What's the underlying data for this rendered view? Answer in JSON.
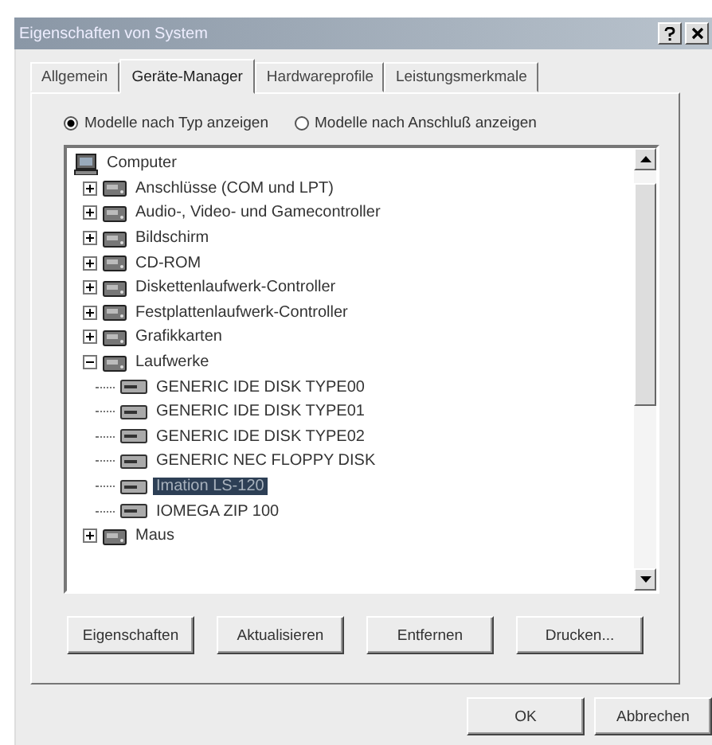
{
  "window": {
    "title": "Eigenschaften von System"
  },
  "tabs": [
    {
      "label": "Allgemein",
      "selected": false
    },
    {
      "label": "Geräte-Manager",
      "selected": true
    },
    {
      "label": "Hardwareprofile",
      "selected": false
    },
    {
      "label": "Leistungsmerkmale",
      "selected": false
    }
  ],
  "view_options": [
    {
      "label": "Modelle nach Typ anzeigen",
      "selected": true
    },
    {
      "label": "Modelle nach Anschluß anzeigen",
      "selected": false
    }
  ],
  "tree": {
    "label": "Computer",
    "selected": false,
    "children": [
      {
        "label": "Anschlüsse (COM und LPT)",
        "expanded": false,
        "selected": false
      },
      {
        "label": "Audio-, Video- und Gamecontroller",
        "expanded": false,
        "selected": false
      },
      {
        "label": "Bildschirm",
        "expanded": false,
        "selected": false
      },
      {
        "label": "CD-ROM",
        "expanded": false,
        "selected": false
      },
      {
        "label": "Diskettenlaufwerk-Controller",
        "expanded": false,
        "selected": false
      },
      {
        "label": "Festplattenlaufwerk-Controller",
        "expanded": false,
        "selected": false
      },
      {
        "label": "Grafikkarten",
        "expanded": false,
        "selected": false
      },
      {
        "label": "Laufwerke",
        "expanded": true,
        "selected": false,
        "children": [
          {
            "label": "GENERIC IDE  DISK TYPE00",
            "selected": false
          },
          {
            "label": "GENERIC IDE  DISK TYPE01",
            "selected": false
          },
          {
            "label": "GENERIC IDE  DISK TYPE02",
            "selected": false
          },
          {
            "label": "GENERIC NEC  FLOPPY DISK",
            "selected": false
          },
          {
            "label": "Imation LS-120",
            "selected": true
          },
          {
            "label": "IOMEGA ZIP 100",
            "selected": false
          }
        ]
      },
      {
        "label": "Maus",
        "expanded": false,
        "selected": false
      }
    ]
  },
  "device_buttons": [
    "Eigenschaften",
    "Aktualisieren",
    "Entfernen",
    "Drucken..."
  ],
  "dialog_buttons": [
    "OK",
    "Abbrechen"
  ]
}
